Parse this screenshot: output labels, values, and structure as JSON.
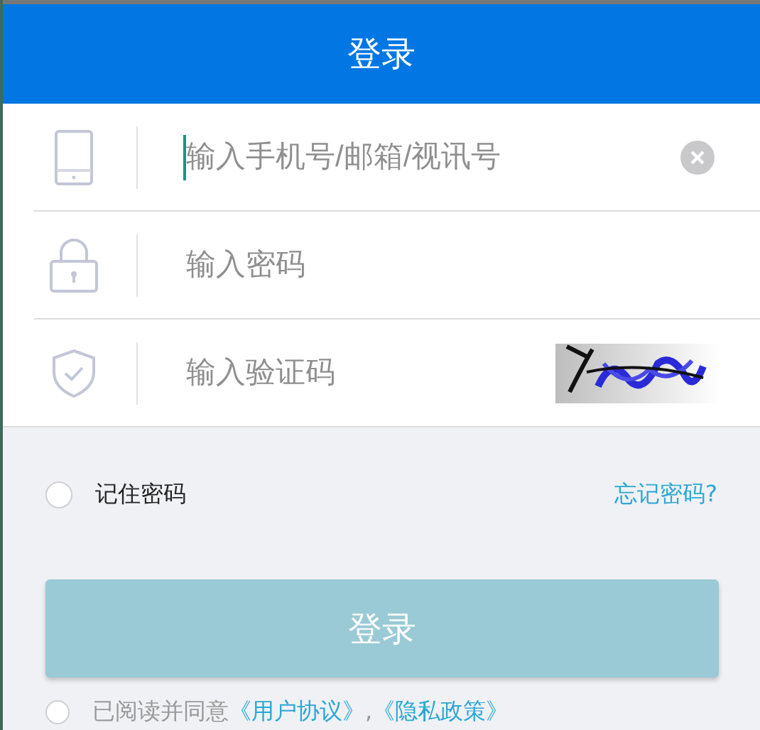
{
  "header": {
    "title": "登录"
  },
  "fields": [
    {
      "kind": "phone",
      "placeholder": "输入手机号/邮箱/视讯号",
      "focused": true,
      "clearable": true
    },
    {
      "kind": "lock",
      "placeholder": "输入密码",
      "focused": false,
      "clearable": false
    },
    {
      "kind": "shield",
      "placeholder": "输入验证码",
      "focused": false,
      "clearable": false
    }
  ],
  "remember": {
    "label": "记住密码",
    "checked": false
  },
  "forgot_link": "忘记密码?",
  "login_button": {
    "label": "登录",
    "disabled": true
  },
  "agreement": {
    "checked": false,
    "text": "已阅读并同意",
    "links": [
      "《用户协议》",
      "《隐私政策》"
    ],
    "separator": ","
  }
}
